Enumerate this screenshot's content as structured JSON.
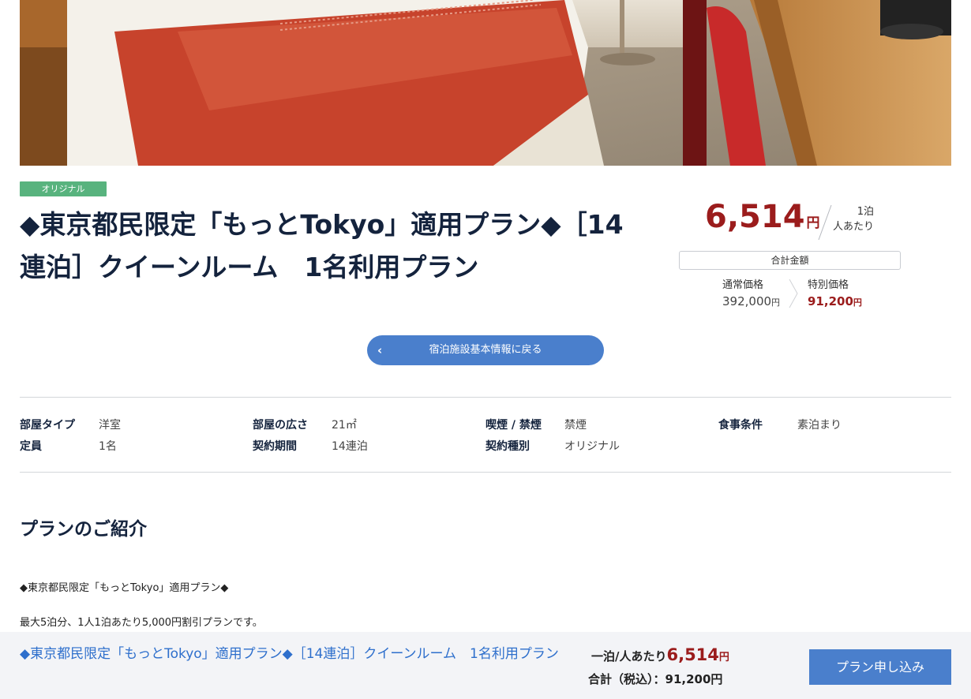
{
  "badge": "オリジナル",
  "title": "◆東京都民限定「もっとTokyo」適用プラン◆［14連泊］クイーンルーム　1名利用プラン",
  "price": {
    "per_night": "6,514",
    "yen": "円",
    "unit_line1": "1泊",
    "unit_line2": "人あたり",
    "total_label": "合計金額",
    "normal_label": "通常価格",
    "normal_value": "392,000",
    "special_label": "特別価格",
    "special_value": "91,200"
  },
  "back_button": "宿泊施設基本情報に戻る",
  "specs": {
    "room_type_label": "部屋タイプ",
    "room_type": "洋室",
    "room_size_label": "部屋の広さ",
    "room_size": "21㎡",
    "smoking_label": "喫煙 / 禁煙",
    "smoking": "禁煙",
    "meal_label": "食事条件",
    "meal": "素泊まり",
    "capacity_label": "定員",
    "capacity": "1名",
    "period_label": "契約期間",
    "period": "14連泊",
    "contract_label": "契約種別",
    "contract": "オリジナル"
  },
  "intro": {
    "heading": "プランのご紹介",
    "line1": "◆東京都民限定「もっとTokyo」適用プラン◆",
    "line2": "最大5泊分、1人1泊あたり5,000円割引プランです。"
  },
  "bottom_bar": {
    "title": "◆東京都民限定「もっとTokyo」適用プラン◆［14連泊］クイーンルーム　1名利用プラン",
    "per_label": "一泊/人あたり",
    "per_value": "6,514",
    "yen": "円",
    "total_label": "合計（税込）：",
    "total_value": "91,200円",
    "apply_button": "プラン申し込み"
  },
  "colors": {
    "accent": "#4a7fcc",
    "price_red": "#9b1c1c",
    "badge_green": "#58b37e",
    "navy": "#14233d"
  }
}
